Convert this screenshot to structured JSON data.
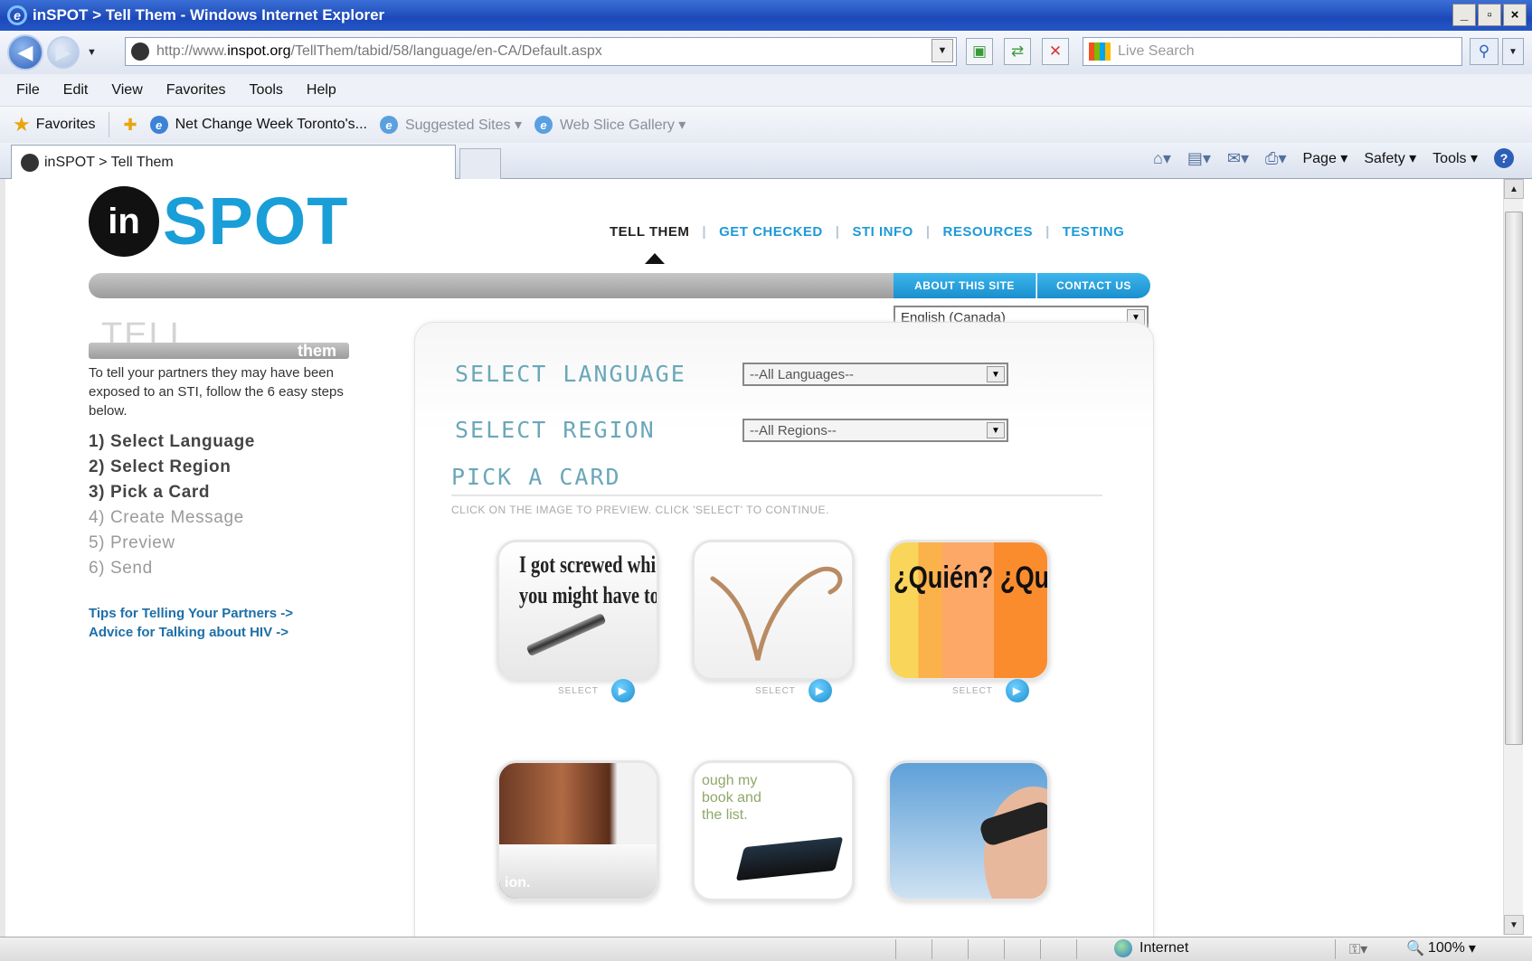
{
  "browser": {
    "title": "inSPOT > Tell Them - Windows Internet Explorer",
    "window_controls": [
      "_",
      "▫",
      "×"
    ],
    "url": {
      "prefix": "http://www.",
      "domain": "inspot.org",
      "path": "/TellThem/tabid/58/language/en-CA/Default.aspx"
    },
    "search_placeholder": "Live Search",
    "menu": [
      "File",
      "Edit",
      "View",
      "Favorites",
      "Tools",
      "Help"
    ],
    "favorites_label": "Favorites",
    "favorites_links": [
      {
        "label": "Net Change Week Toronto's..."
      },
      {
        "label": "Suggested Sites ▾"
      },
      {
        "label": "Web Slice Gallery ▾"
      }
    ],
    "tab_title": "inSPOT > Tell Them",
    "command_items": [
      "Page ▾",
      "Safety ▾",
      "Tools ▾"
    ],
    "status_zone": "Internet",
    "zoom": "100%"
  },
  "site": {
    "logo_in": "in",
    "logo_spot": "SPOT",
    "nav": [
      {
        "label": "TELL THEM",
        "active": true
      },
      {
        "label": "GET CHECKED"
      },
      {
        "label": "STI INFO"
      },
      {
        "label": "RESOURCES"
      },
      {
        "label": "TESTING"
      }
    ],
    "about_label": "ABOUT THIS SITE",
    "contact_label": "CONTACT US",
    "language_value": "English (Canada)"
  },
  "left": {
    "heading_tell": "TELL",
    "heading_them": "them",
    "intro": "To tell your partners they may have been exposed to an STI, follow the 6 easy steps below.",
    "steps": [
      "1) Select Language",
      "2) Select Region",
      "3) Pick a Card",
      "4) Create Message",
      "5) Preview",
      "6) Send"
    ],
    "tips": [
      "Tips for Telling Your Partners ->",
      "Advice for Talking about HIV ->"
    ]
  },
  "panel": {
    "select_language_label": "SELECT LANGUAGE",
    "language_dropdown": "--All Languages--",
    "select_region_label": "SELECT REGION",
    "region_dropdown": "--All Regions--",
    "pick_title": "PICK A CARD",
    "pick_subtitle": "CLICK ON THE IMAGE TO PREVIEW. CLICK 'SELECT' TO CONTINUE.",
    "select_label": "SELECT",
    "cards": [
      {
        "caption_line1": "I got screwed whi",
        "caption_line2": "you might have to"
      },
      {
        "caption": ""
      },
      {
        "caption": "¿Quién? ¿Qu"
      },
      {
        "caption": "ion."
      },
      {
        "caption_line1": "ough my",
        "caption_line2": "book and",
        "caption_line3": "the list."
      },
      {
        "caption": ""
      }
    ]
  }
}
